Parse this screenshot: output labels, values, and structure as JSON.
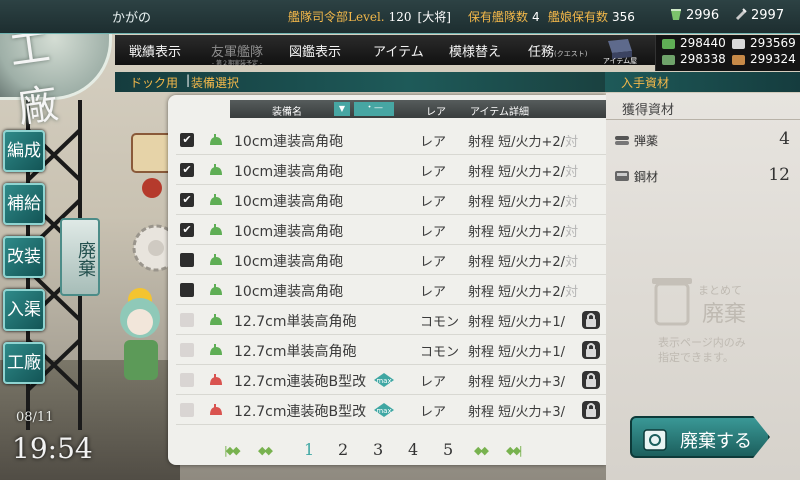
{
  "header": {
    "admiral_name": "かがの",
    "hq_level_label": "艦隊司令部Level.",
    "hq_level": "120",
    "rank": "[大将]",
    "ship_count_label": "保有艦隊数",
    "ship_count": "4",
    "equip_count_label": "艦娘保有数",
    "equip_count": "356",
    "buckets": "2996",
    "screws": "2997"
  },
  "menu": {
    "items": [
      {
        "label": "戦績表示"
      },
      {
        "label": "友軍艦隊",
        "sub": "- 第２期実装予定 -"
      },
      {
        "label": "図鑑表示"
      },
      {
        "label": "アイテム"
      },
      {
        "label": "模様替え"
      },
      {
        "label": "任務",
        "small": "(クエスト)"
      }
    ],
    "itemshop_label": "アイテム屋"
  },
  "resources": {
    "fuel": "298440",
    "steel": "293569",
    "ammo": "298338",
    "bauxite": "299324"
  },
  "breadcrumb": {
    "dock": "ドック用",
    "separator": "|",
    "equip": "装備選択",
    "right": "入手資材"
  },
  "side_nav": {
    "items": [
      "編成",
      "補給",
      "改装",
      "入渠",
      "工廠"
    ],
    "fab": "廃棄"
  },
  "clock": {
    "date": "08/11",
    "time": "19:54"
  },
  "list": {
    "header": {
      "name": "装備名",
      "sort": "▼",
      "filter": "・—",
      "rarity": "レア",
      "detail": "アイテム詳細"
    },
    "rows": [
      {
        "name": "10cm連装高角砲",
        "rarity": "レア",
        "detail": "射程 短/火力+2/",
        "fade": "対",
        "checked": true,
        "color": "#5fae55"
      },
      {
        "name": "10cm連装高角砲",
        "rarity": "レア",
        "detail": "射程 短/火力+2/",
        "fade": "対",
        "checked": true,
        "color": "#5fae55"
      },
      {
        "name": "10cm連装高角砲",
        "rarity": "レア",
        "detail": "射程 短/火力+2/",
        "fade": "対",
        "checked": true,
        "color": "#5fae55"
      },
      {
        "name": "10cm連装高角砲",
        "rarity": "レア",
        "detail": "射程 短/火力+2/",
        "fade": "対",
        "checked": true,
        "color": "#5fae55"
      },
      {
        "name": "10cm連装高角砲",
        "rarity": "レア",
        "detail": "射程 短/火力+2/",
        "fade": "対",
        "checked": false,
        "dark": true,
        "color": "#5fae55"
      },
      {
        "name": "10cm連装高角砲",
        "rarity": "レア",
        "detail": "射程 短/火力+2/",
        "fade": "対",
        "checked": false,
        "dark": true,
        "color": "#5fae55"
      },
      {
        "name": "12.7cm単装高角砲",
        "rarity": "コモン",
        "detail": "射程 短/火力+1/",
        "fade": "",
        "checked": false,
        "color": "#5fae55",
        "lock": true
      },
      {
        "name": "12.7cm単装高角砲",
        "rarity": "コモン",
        "detail": "射程 短/火力+1/",
        "fade": "",
        "checked": false,
        "color": "#5fae55",
        "lock": true
      },
      {
        "name": "12.7cm連装砲B型改",
        "rarity": "レア",
        "detail": "射程 短/火力+3/",
        "fade": "",
        "checked": false,
        "color": "#d9534f",
        "max": true,
        "lock": true
      },
      {
        "name": "12.7cm連装砲B型改",
        "rarity": "レア",
        "detail": "射程 短/火力+3/",
        "fade": "",
        "checked": false,
        "color": "#d9534f",
        "max": true,
        "lock": true
      }
    ],
    "max_label": "max"
  },
  "pager": {
    "pages": [
      "1",
      "2",
      "3",
      "4",
      "5"
    ],
    "current": "1"
  },
  "materials": {
    "title": "獲得資材",
    "items": [
      {
        "name": "弾薬",
        "value": "4"
      },
      {
        "name": "鋼材",
        "value": "12"
      }
    ]
  },
  "bulk": {
    "line1": "まとめて",
    "line2": "廃棄",
    "line3": "表示ページ内のみ",
    "line4": "指定できます。"
  },
  "scrap_button": "廃棄する",
  "colors": {
    "accent": "#3fa7a3",
    "gold": "#f3b84a",
    "teal_bar": "#1e5a59"
  }
}
